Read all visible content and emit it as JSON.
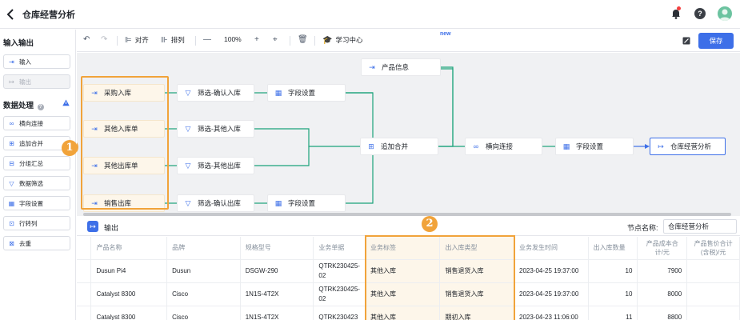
{
  "header": {
    "title": "仓库经营分析"
  },
  "sidebar": {
    "section_io": "输入输出",
    "io_items": [
      {
        "label": "输入",
        "icon": "input-icon",
        "disabled": false
      },
      {
        "label": "输出",
        "icon": "output-icon",
        "disabled": true
      }
    ],
    "section_process": "数据处理",
    "process_items": [
      {
        "label": "横向连接",
        "icon": "join-icon"
      },
      {
        "label": "追加合并",
        "icon": "append-icon"
      },
      {
        "label": "分组汇总",
        "icon": "group-icon"
      },
      {
        "label": "数据筛选",
        "icon": "filter-icon"
      },
      {
        "label": "字段设置",
        "icon": "table-icon"
      },
      {
        "label": "行转列",
        "icon": "pivot-icon"
      },
      {
        "label": "去重",
        "icon": "dedupe-icon"
      }
    ]
  },
  "toolbar": {
    "align": "对齐",
    "arrange": "排列",
    "zoom": "100%",
    "learn": "学习中心",
    "new_badge": "new",
    "save": "保存"
  },
  "canvas": {
    "nodes": [
      {
        "id": "src1",
        "label": "采购入库"
      },
      {
        "id": "src2",
        "label": "其他入库单"
      },
      {
        "id": "src3",
        "label": "其他出库单"
      },
      {
        "id": "src4",
        "label": "销售出库"
      },
      {
        "id": "f1",
        "label": "筛选-确认入库"
      },
      {
        "id": "f2",
        "label": "筛选-其他入库"
      },
      {
        "id": "f3",
        "label": "筛选-其他出库"
      },
      {
        "id": "f4",
        "label": "筛选-确认出库"
      },
      {
        "id": "fs1",
        "label": "字段设置"
      },
      {
        "id": "fs4",
        "label": "字段设置"
      },
      {
        "id": "prod",
        "label": "产品信息"
      },
      {
        "id": "append",
        "label": "追加合并"
      },
      {
        "id": "join",
        "label": "横向连接"
      },
      {
        "id": "fs5",
        "label": "字段设置"
      },
      {
        "id": "out",
        "label": "仓库经营分析"
      }
    ],
    "badge1": "1",
    "badge2": "2"
  },
  "output_panel": {
    "label": "输出",
    "node_name_label": "节点名称:",
    "node_name_value": "仓库经营分析"
  },
  "table": {
    "columns": [
      "产品名称",
      "品牌",
      "规格型号",
      "业务单据",
      "业务标签",
      "出入库类型",
      "业务发生时间",
      "出入库数量",
      "产品成本合计/元",
      "产品售价合计(含税)/元"
    ],
    "rows": [
      [
        "Dusun Pi4",
        "Dusun",
        "DSGW-290",
        "QTRK230425-02",
        "其他入库",
        "销售退货入库",
        "2023-04-25 19:37:00",
        "10",
        "7900",
        ""
      ],
      [
        "Catalyst 8300",
        "Cisco",
        "1N1S-4T2X",
        "QTRK230425-02",
        "其他入库",
        "销售退货入库",
        "2023-04-25 19:37:00",
        "10",
        "8000",
        ""
      ],
      [
        "Catalyst 8300",
        "Cisco",
        "1N1S-4T2X",
        "QTRK230423",
        "其他入库",
        "期初入库",
        "2023-04-23 11:06:00",
        "11",
        "8800",
        ""
      ]
    ]
  },
  "colors": {
    "accent": "#3d6fe8",
    "highlight": "#f1a33a",
    "flow_line": "#1aa37a"
  }
}
